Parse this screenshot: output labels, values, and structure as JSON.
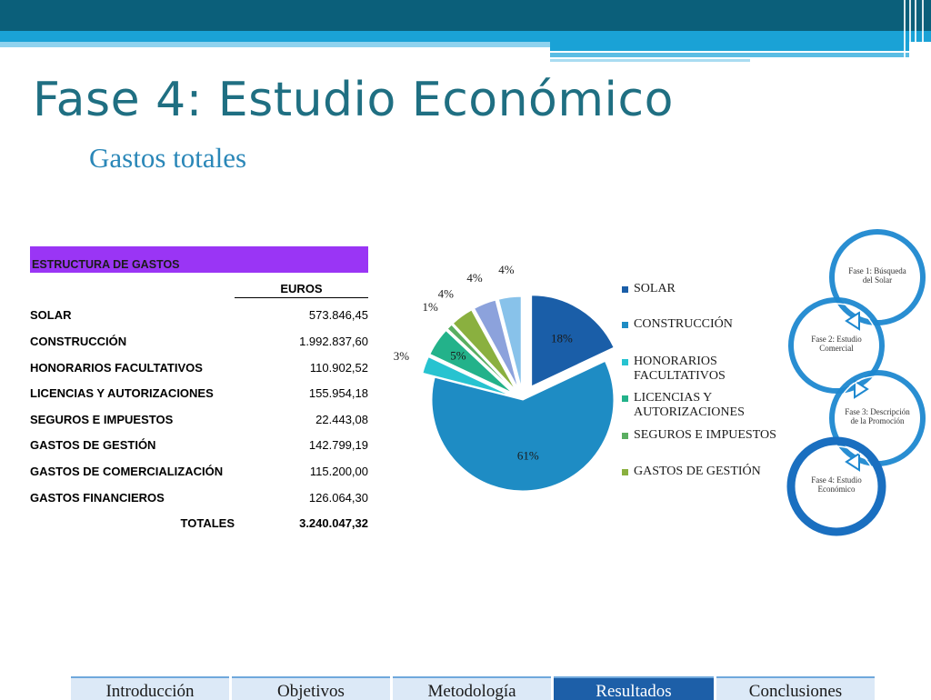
{
  "slide": {
    "title": "Fase 4: Estudio Económico",
    "subtitle": "Gastos totales"
  },
  "table": {
    "header": "ESTRUCTURA DE GASTOS",
    "header_color": "#9a35f5",
    "column_label": "EUROS",
    "rows": [
      {
        "label": "SOLAR",
        "value": "573.846,45"
      },
      {
        "label": "CONSTRUCCIÓN",
        "value": "1.992.837,60"
      },
      {
        "label": "HONORARIOS FACULTATIVOS",
        "value": "110.902,52"
      },
      {
        "label": "LICENCIAS Y AUTORIZACIONES",
        "value": "155.954,18"
      },
      {
        "label": "SEGUROS E IMPUESTOS",
        "value": "22.443,08"
      },
      {
        "label": "GASTOS DE GESTIÓN",
        "value": "142.799,19"
      },
      {
        "label": "GASTOS DE COMERCIALIZACIÓN",
        "value": "115.200,00"
      },
      {
        "label": "GASTOS FINANCIEROS",
        "value": "126.064,30"
      }
    ],
    "total_label": "TOTALES",
    "total_value": "3.240.047,32"
  },
  "chart_data": {
    "type": "pie",
    "slices": [
      {
        "name": "SOLAR",
        "value": 18,
        "label": "18%",
        "color": "#1a5ea8"
      },
      {
        "name": "CONSTRUCCIÓN",
        "value": 61,
        "label": "61%",
        "color": "#1e8cc4"
      },
      {
        "name": "HONORARIOS FACULTATIVOS",
        "value": 3,
        "label": "3%",
        "color": "#27c3d0"
      },
      {
        "name": "LICENCIAS Y AUTORIZACIONES",
        "value": 5,
        "label": "5%",
        "color": "#23b28a"
      },
      {
        "name": "SEGUROS E IMPUESTOS",
        "value": 1,
        "label": "1%",
        "color": "#5aae61"
      },
      {
        "name": "GASTOS DE GESTIÓN",
        "value": 4,
        "label": "4%",
        "color": "#8ab03f"
      },
      {
        "name": "GASTOS DE COMERCIALIZACIÓN",
        "value": 4,
        "label": "4%",
        "color": "#8ca2dc"
      },
      {
        "name": "GASTOS FINANCIEROS",
        "value": 4,
        "label": "4%",
        "color": "#88c2ea"
      }
    ],
    "legend": [
      {
        "label": "SOLAR",
        "color": "#1a5ea8"
      },
      {
        "label": "CONSTRUCCIÓN",
        "color": "#1e8cc4"
      },
      {
        "label": "HONORARIOS FACULTATIVOS",
        "color": "#27c3d0"
      },
      {
        "label": "LICENCIAS Y AUTORIZACIONES",
        "color": "#23b28a"
      },
      {
        "label": "SEGUROS E IMPUESTOS",
        "color": "#5aae61"
      },
      {
        "label": "GASTOS DE GESTIÓN",
        "color": "#8ab03f"
      }
    ],
    "legend_position": "right",
    "exploded": true
  },
  "cycle": {
    "steps": [
      {
        "lines": [
          "Fase 1: Búsqueda",
          "del  Solar"
        ]
      },
      {
        "lines": [
          "Fase 2: Estudio",
          "Comercial"
        ]
      },
      {
        "lines": [
          "Fase 3: Descripción",
          "de la      Promoción"
        ]
      },
      {
        "lines": [
          "Fase 4: Estudio",
          "Económico"
        ]
      }
    ],
    "active_index": 3,
    "ring_color": "#1e88d0",
    "active_color": "#1a6fc0"
  },
  "nav": {
    "tabs": [
      {
        "label": "Introducción",
        "active": false
      },
      {
        "label": "Objetivos",
        "active": false
      },
      {
        "label": "Metodología",
        "active": false
      },
      {
        "label": "Resultados",
        "active": true
      },
      {
        "label": "Conclusiones",
        "active": false
      }
    ],
    "inactive_color": "#dce9f7",
    "active_color": "#1d5fa8"
  }
}
